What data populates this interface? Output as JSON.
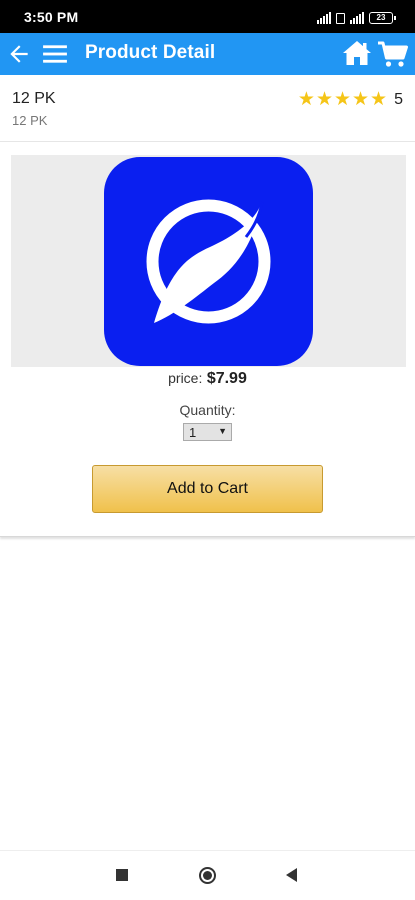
{
  "status_bar": {
    "time": "3:50 PM",
    "battery": "23",
    "icons": [
      "signal-icon",
      "sim-icon",
      "signal-4g-icon",
      "battery-icon"
    ]
  },
  "app_bar": {
    "title": "Product Detail",
    "background": "#2196f3",
    "icons": [
      "back-arrow-icon",
      "hamburger-menu-icon",
      "home-icon",
      "shopping-cart-icon"
    ]
  },
  "product": {
    "name": "12 PK",
    "subtitle": "12 PK",
    "stars": "★★★★★",
    "rating": "5",
    "star_color": "#f5c518"
  },
  "image": {
    "logo_color": "#0a1ff0",
    "icon": "orbit-s-logo"
  },
  "price": {
    "label": "price:",
    "value": "$7.99"
  },
  "quantity": {
    "label": "Quantity:",
    "selected": "1"
  },
  "actions": {
    "add_to_cart": "Add to Cart",
    "button_color": "#f0c14b"
  },
  "nav": {
    "icons": [
      "recent-apps-icon",
      "home-circle-icon",
      "back-triangle-icon"
    ]
  }
}
